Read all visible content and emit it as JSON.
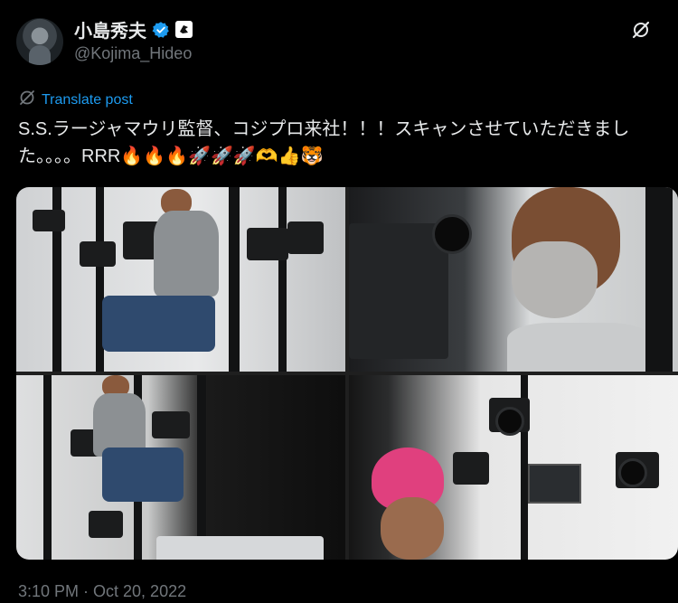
{
  "author": {
    "display_name": "小島秀夫",
    "handle": "@Kojima_Hideo"
  },
  "translate": {
    "label": "Translate post"
  },
  "post": {
    "text": "S.S.ラージャマウリ監督、コジプロ来社！！！スキャンさせていただきました。。。。RRR🔥🔥🔥🚀🚀🚀🫶👍🐯"
  },
  "media": {
    "photos": [
      "photo-1",
      "photo-2",
      "photo-3",
      "photo-4"
    ]
  },
  "meta": {
    "timestamp": "3:10 PM · Oct 20, 2022"
  },
  "colors": {
    "accent": "#1d9bf0",
    "background": "#000000",
    "text": "#e7e9ea",
    "muted": "#71767b"
  },
  "icons": [
    "avatar",
    "verified-icon",
    "affiliate-badge-icon",
    "grok-icon",
    "translate-icon"
  ]
}
